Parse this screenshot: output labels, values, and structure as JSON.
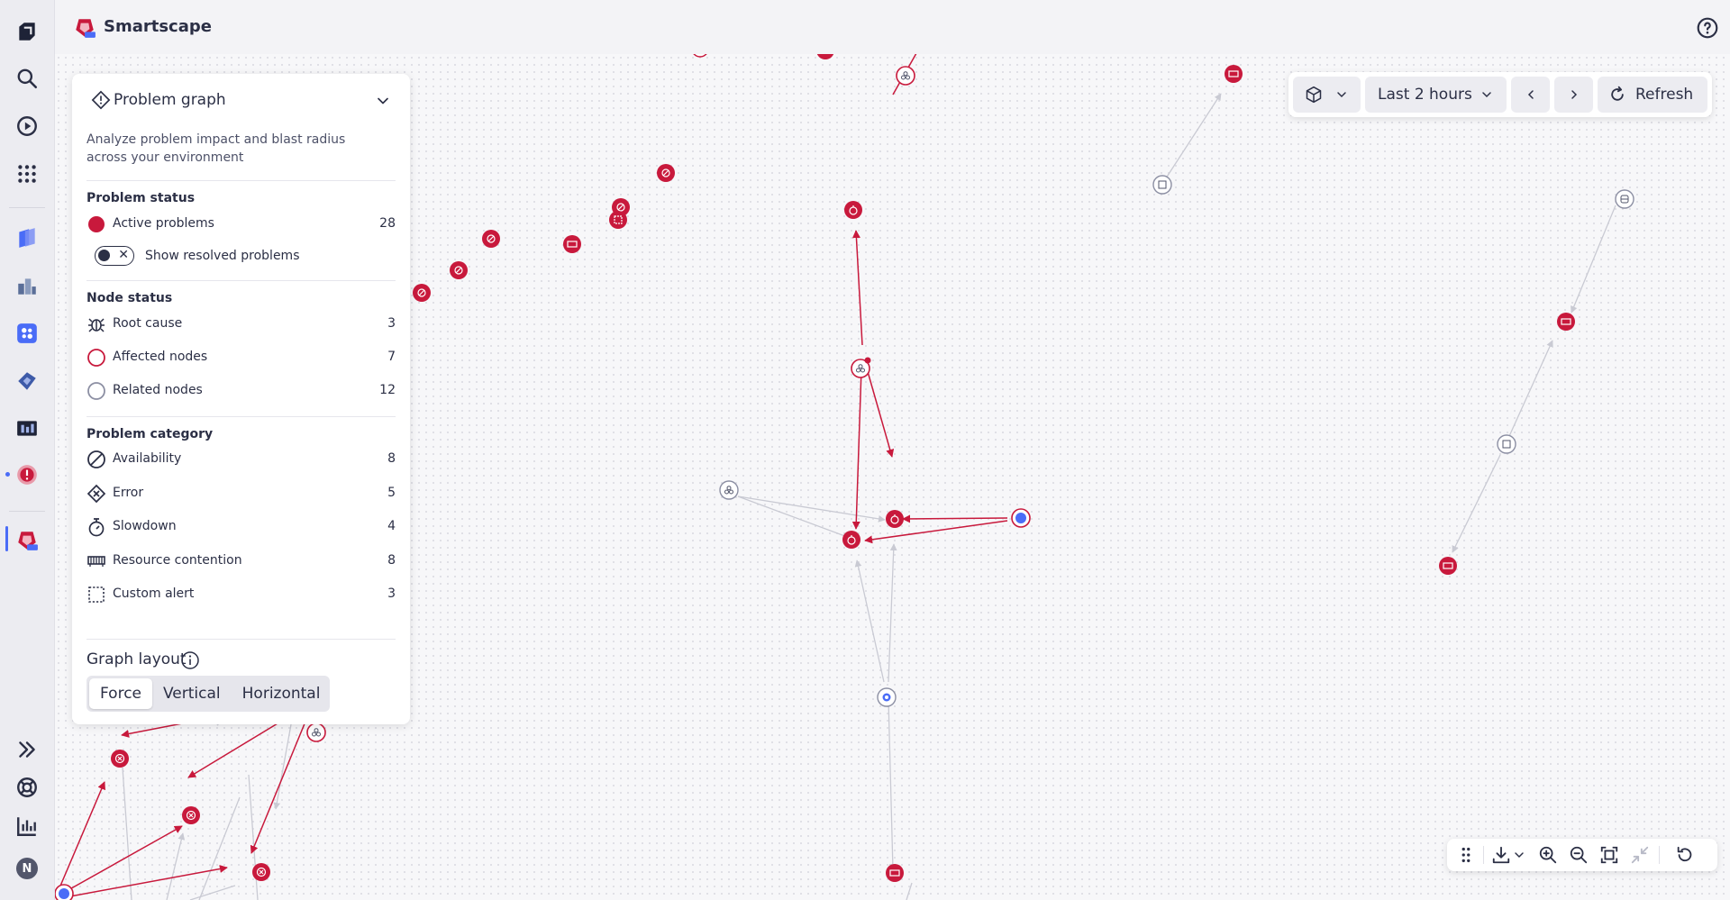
{
  "app": {
    "title": "Smartscape"
  },
  "panel": {
    "title": "Problem graph",
    "description": "Analyze problem impact and blast radius across your environment",
    "problem_status": {
      "heading": "Problem status",
      "active_label": "Active problems",
      "active_count": "28",
      "toggle_label": "Show resolved problems"
    },
    "node_status": {
      "heading": "Node status",
      "items": [
        {
          "label": "Root cause",
          "count": "3",
          "icon": "bug-icon"
        },
        {
          "label": "Affected nodes",
          "count": "7",
          "icon": "ring-red-icon"
        },
        {
          "label": "Related nodes",
          "count": "12",
          "icon": "ring-gray-icon"
        }
      ]
    },
    "problem_category": {
      "heading": "Problem category",
      "items": [
        {
          "label": "Availability",
          "count": "8",
          "icon": "availability-icon"
        },
        {
          "label": "Error",
          "count": "5",
          "icon": "error-icon"
        },
        {
          "label": "Slowdown",
          "count": "4",
          "icon": "stopwatch-icon"
        },
        {
          "label": "Resource contention",
          "count": "8",
          "icon": "resource-icon"
        },
        {
          "label": "Custom alert",
          "count": "3",
          "icon": "custom-alert-icon"
        }
      ]
    },
    "graph_layout": {
      "title": "Graph layout",
      "options": [
        "Force",
        "Vertical",
        "Horizontal"
      ],
      "selected": "Force"
    }
  },
  "toolbar": {
    "timeframe": "Last 2 hours",
    "refresh": "Refresh"
  },
  "avatar_initial": "N",
  "colors": {
    "problem_red": "#c8193c",
    "accent_blue": "#4a6cf7",
    "edge_gray": "#c9cad3"
  }
}
